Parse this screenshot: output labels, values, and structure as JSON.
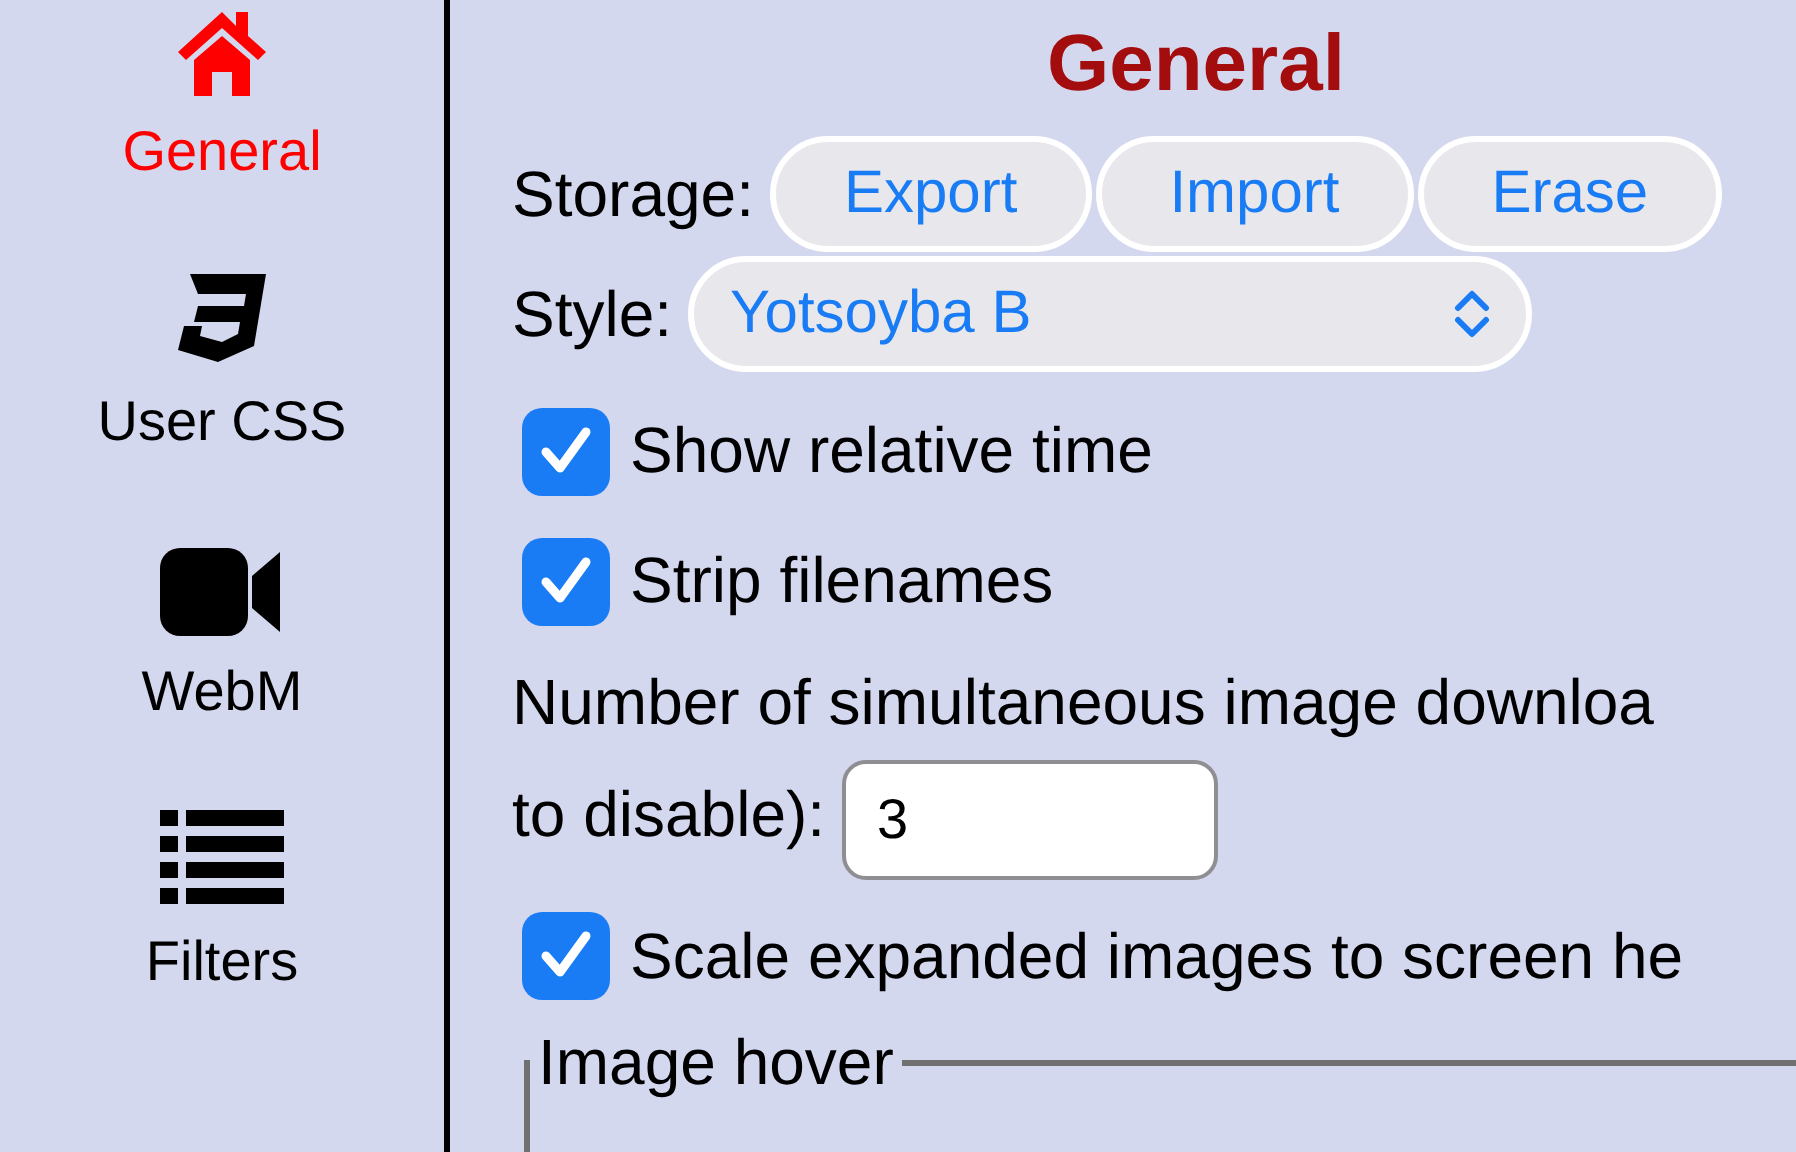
{
  "sidebar": {
    "items": [
      {
        "label": "General",
        "selected": true
      },
      {
        "label": "User CSS",
        "selected": false
      },
      {
        "label": "WebM",
        "selected": false
      },
      {
        "label": "Filters",
        "selected": false
      }
    ]
  },
  "content": {
    "title": "General",
    "storage": {
      "label": "Storage:",
      "buttons": [
        "Export",
        "Import",
        "Erase"
      ]
    },
    "style": {
      "label": "Style:",
      "value": "Yotsoyba B"
    },
    "options": [
      {
        "kind": "checkbox",
        "label": "Show relative time",
        "checked": true
      },
      {
        "kind": "checkbox",
        "label": "Strip filenames",
        "checked": true
      },
      {
        "kind": "number",
        "label_lines": [
          "Number of simultaneous image downloa",
          "to disable):"
        ],
        "value": "3"
      },
      {
        "kind": "checkbox",
        "label": "Scale expanded images to screen he",
        "checked": true
      }
    ],
    "fieldset": {
      "legend": "Image hover"
    }
  }
}
